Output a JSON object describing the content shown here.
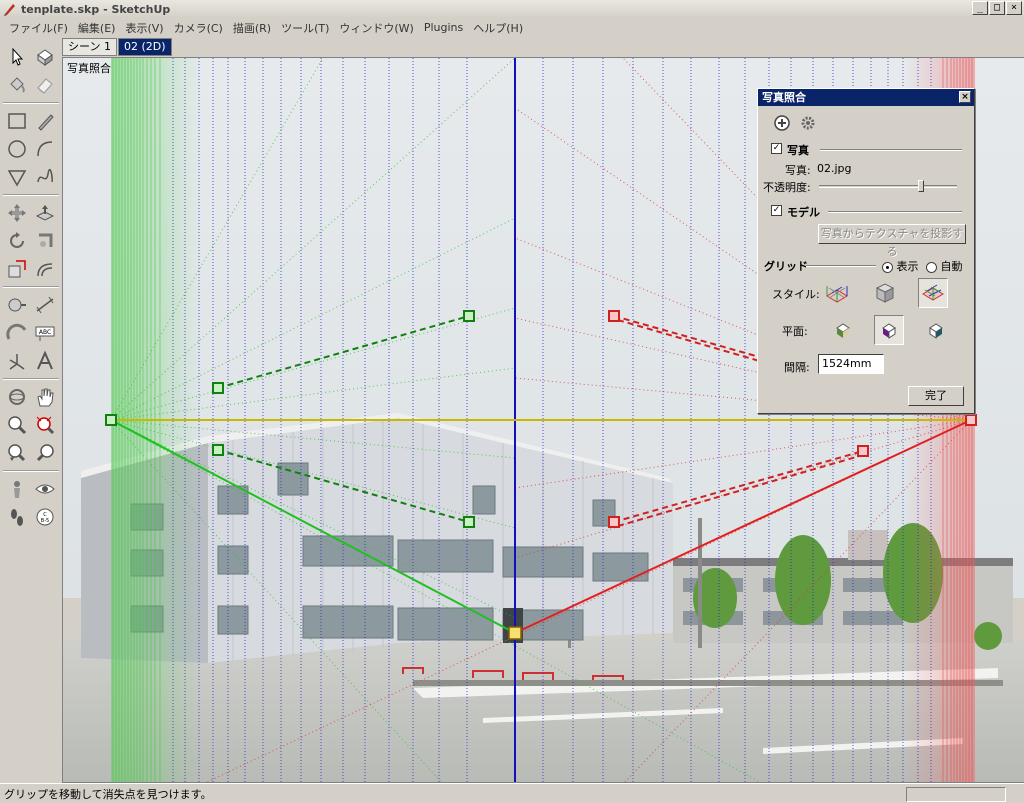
{
  "window": {
    "title": "tenplate.skp - SketchUp",
    "minimize": "_",
    "maximize": "□",
    "close": "×"
  },
  "menu": [
    "ファイル(F)",
    "編集(E)",
    "表示(V)",
    "カメラ(C)",
    "描画(R)",
    "ツール(T)",
    "ウィンドウ(W)",
    "Plugins",
    "ヘルプ(H)"
  ],
  "tabs": [
    "シーン 1",
    "02 (2D)"
  ],
  "viewport": {
    "mode_label": "写真照合"
  },
  "dialog": {
    "title": "写真照合",
    "close": "×",
    "photo_section": "写真",
    "photo_file_label": "写真:",
    "photo_file": "02.jpg",
    "opacity_label": "不透明度:",
    "opacity_value": 0.75,
    "model_section": "モデル",
    "project_texture_button": "写真からテクスチャを投影する",
    "grid_label": "グリッド",
    "grid_show": "表示",
    "grid_auto": "自動",
    "style_label": "スタイル:",
    "plane_label": "平面:",
    "spacing_label": "間隔:",
    "spacing_value": "1524mm",
    "done_button": "完了",
    "photo_checked": "✓",
    "model_checked": "✓"
  },
  "status": {
    "text": "グリップを移動して消失点を見つけます。"
  },
  "colors": {
    "title_active": "#0a246a",
    "red_axis": "#e02020",
    "green_axis": "#20c020",
    "blue_axis": "#1010c0",
    "horizon": "#d8c800"
  }
}
